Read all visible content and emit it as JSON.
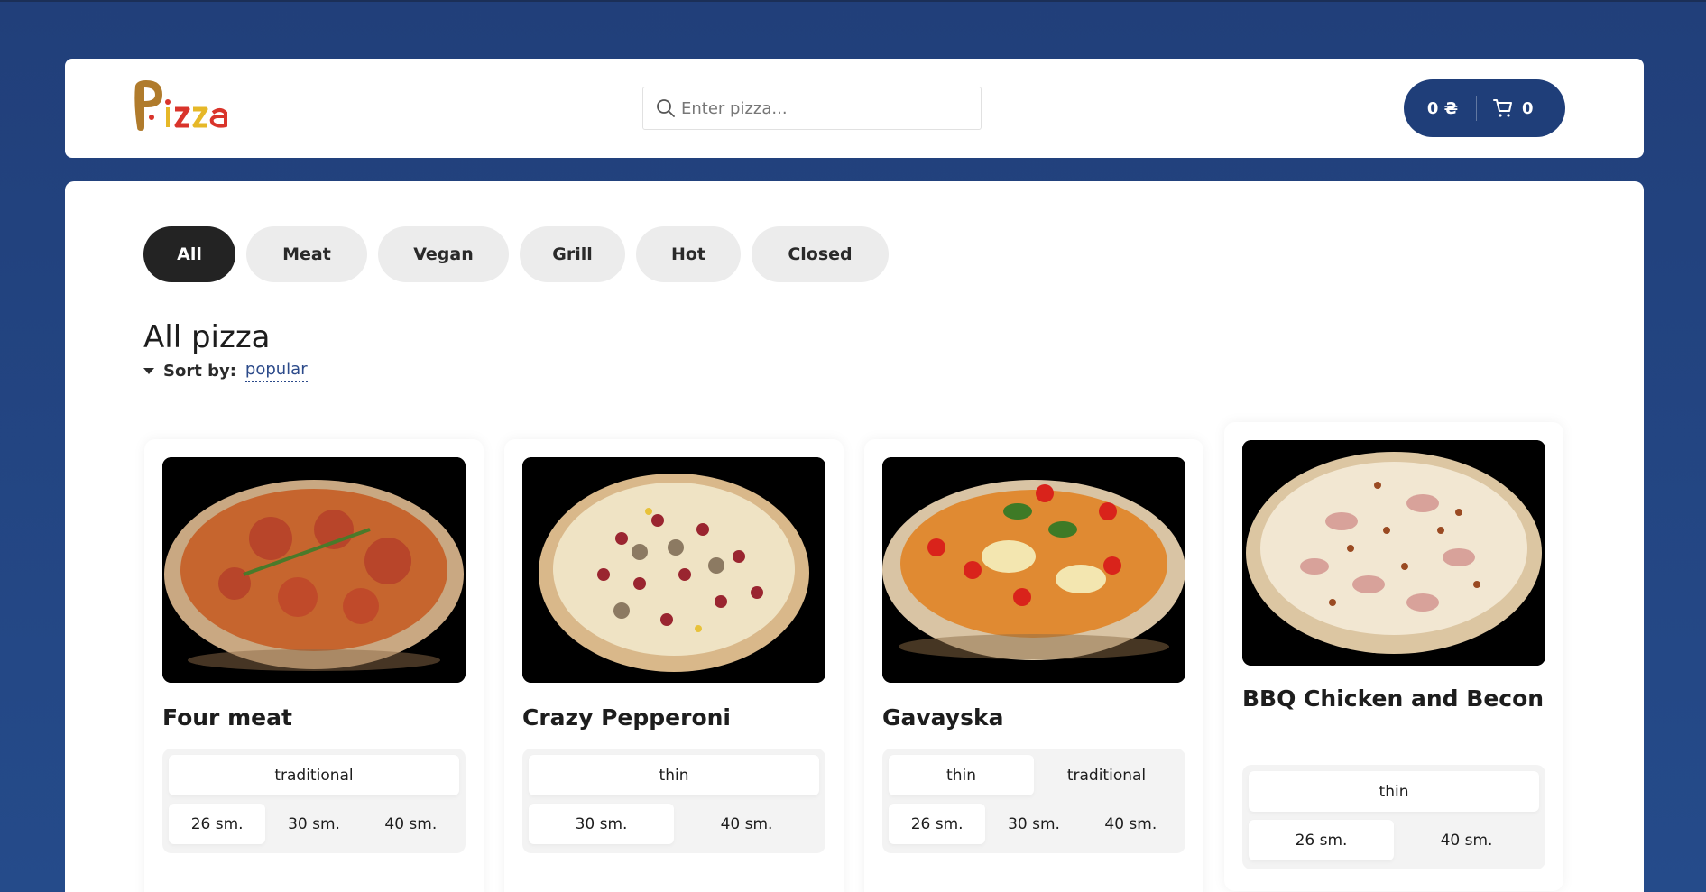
{
  "header": {
    "logo_text": "Pizza",
    "search": {
      "placeholder": "Enter pizza..."
    },
    "cart": {
      "price": "0 ₴",
      "count": "0"
    }
  },
  "categories": [
    {
      "label": "All",
      "active": true
    },
    {
      "label": "Meat",
      "active": false
    },
    {
      "label": "Vegan",
      "active": false
    },
    {
      "label": "Grill",
      "active": false
    },
    {
      "label": "Hot",
      "active": false
    },
    {
      "label": "Closed",
      "active": false
    }
  ],
  "main": {
    "title": "All pizza",
    "sort_label": "Sort by:",
    "sort_value": "popular"
  },
  "pizzas": [
    {
      "name": "Four meat",
      "types": [
        {
          "label": "traditional",
          "selected": true
        }
      ],
      "sizes": [
        {
          "label": "26 sm.",
          "selected": true
        },
        {
          "label": "30 sm.",
          "selected": false
        },
        {
          "label": "40 sm.",
          "selected": false
        }
      ]
    },
    {
      "name": "Crazy Pepperoni",
      "types": [
        {
          "label": "thin",
          "selected": true
        }
      ],
      "sizes": [
        {
          "label": "30 sm.",
          "selected": true
        },
        {
          "label": "40 sm.",
          "selected": false
        }
      ]
    },
    {
      "name": "Gavayska",
      "types": [
        {
          "label": "thin",
          "selected": true
        },
        {
          "label": "traditional",
          "selected": false
        }
      ],
      "sizes": [
        {
          "label": "26 sm.",
          "selected": true
        },
        {
          "label": "30 sm.",
          "selected": false
        },
        {
          "label": "40 sm.",
          "selected": false
        }
      ]
    },
    {
      "name": "BBQ Chicken and Becon",
      "types": [
        {
          "label": "thin",
          "selected": true
        }
      ],
      "sizes": [
        {
          "label": "26 sm.",
          "selected": true
        },
        {
          "label": "40 sm.",
          "selected": false
        }
      ]
    }
  ],
  "colors": {
    "background": "#254b8a",
    "cart_button": "#1f3e79",
    "active_category": "#232323",
    "sort_link": "#2c4a8a"
  }
}
